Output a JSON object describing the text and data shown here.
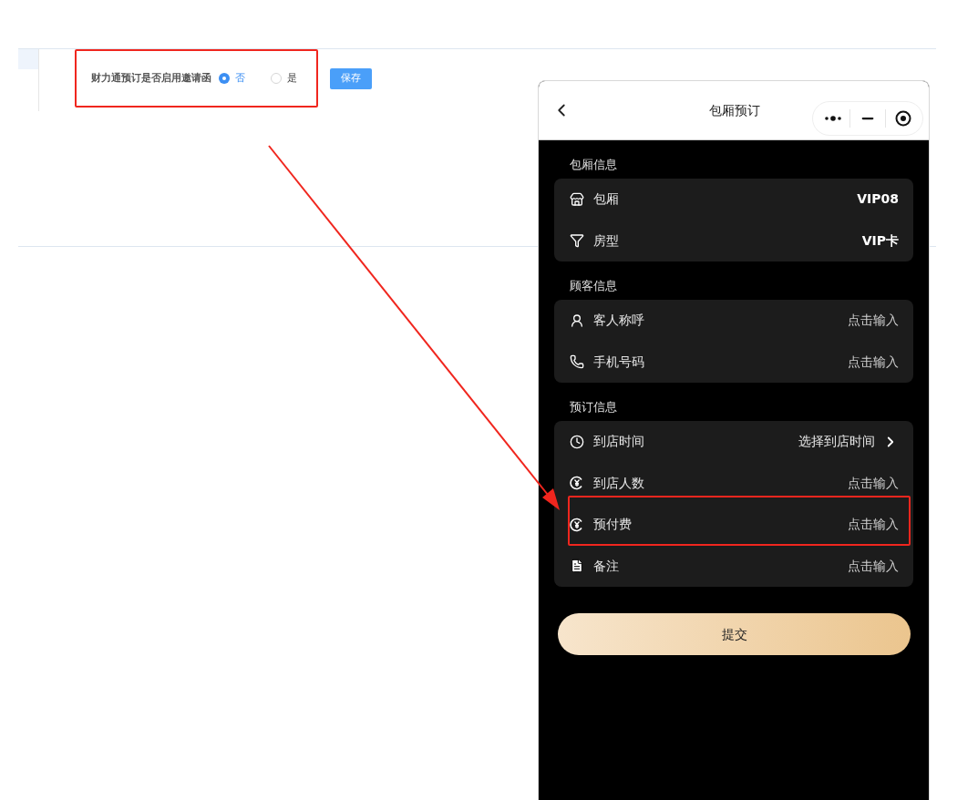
{
  "settings": {
    "label": "财力通预订是否启用邀请函",
    "options": [
      {
        "label": "否",
        "selected": true
      },
      {
        "label": "是",
        "selected": false
      }
    ],
    "save_button": "保存"
  },
  "phone": {
    "title": "包厢预订",
    "sections": [
      {
        "title": "包厢信息",
        "rows": [
          {
            "label": "包厢",
            "value": "VIP08",
            "kind": "value"
          },
          {
            "label": "房型",
            "value": "VIP卡",
            "kind": "value"
          }
        ]
      },
      {
        "title": "顾客信息",
        "rows": [
          {
            "label": "客人称呼",
            "value": "点击输入",
            "kind": "placeholder"
          },
          {
            "label": "手机号码",
            "value": "点击输入",
            "kind": "placeholder"
          }
        ]
      },
      {
        "title": "预订信息",
        "rows": [
          {
            "label": "到店时间",
            "value": "选择到店时间",
            "kind": "picker"
          },
          {
            "label": "到店人数",
            "value": "点击输入",
            "kind": "placeholder"
          },
          {
            "label": "预付费",
            "value": "点击输入",
            "kind": "placeholder"
          },
          {
            "label": "备注",
            "value": "点击输入",
            "kind": "placeholder"
          }
        ]
      }
    ],
    "submit_button": "提交"
  }
}
